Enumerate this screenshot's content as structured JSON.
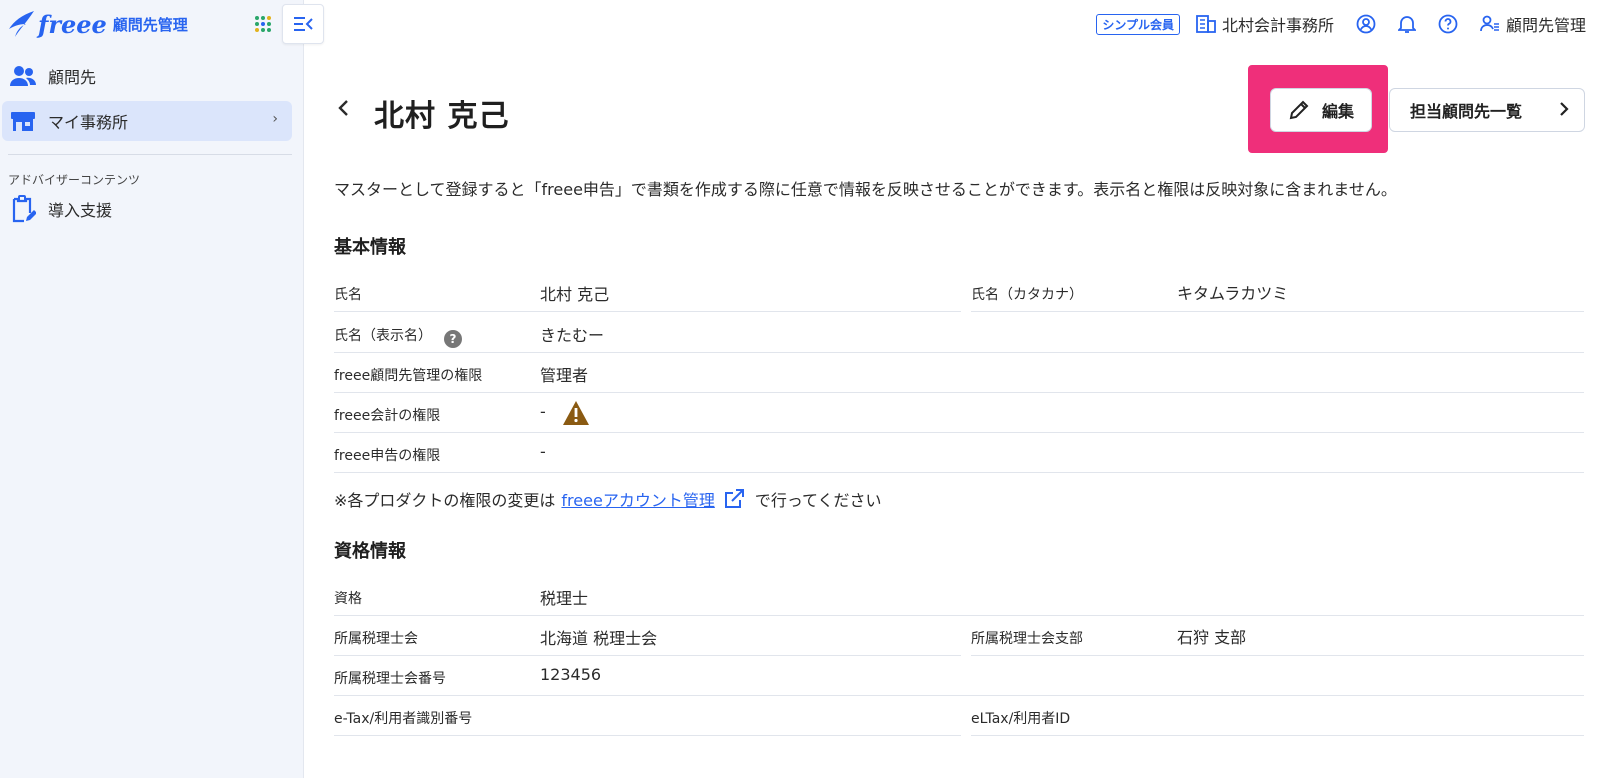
{
  "brand": {
    "logo_text": "freee",
    "product_name": "顧問先管理",
    "accent": "#2864f0",
    "highlight": "#ef2f7a"
  },
  "sidebar": {
    "items": [
      {
        "label": "顧問先",
        "icon": "users-icon"
      },
      {
        "label": "マイ事務所",
        "icon": "office-icon",
        "active": true
      }
    ],
    "section_heading": "アドバイザーコンテンツ",
    "section_items": [
      {
        "label": "導入支援",
        "icon": "clipboard-edit-icon"
      }
    ]
  },
  "header": {
    "plan_badge": "シンプル会員",
    "office_name": "北村会計事務所",
    "account_label": "顧問先管理"
  },
  "page": {
    "title": "北村 克己",
    "edit_label": "編集",
    "list_label": "担当顧問先一覧",
    "description": "マスターとして登録すると「freee申告」で書類を作成する際に任意で情報を反映させることができます。表示名と権限は反映対象に含まれません。"
  },
  "basic_info": {
    "title": "基本情報",
    "rows": [
      {
        "label": "氏名",
        "value": "北村 克己"
      },
      {
        "label": "氏名（カタカナ）",
        "value": "キタムラカツミ"
      },
      {
        "label": "氏名（表示名）",
        "value": "きたむー"
      },
      {
        "label": "freee顧問先管理の権限",
        "value": "管理者"
      },
      {
        "label": "freee会計の権限",
        "value": "-"
      },
      {
        "label": "freee申告の権限",
        "value": "-"
      }
    ]
  },
  "note": {
    "prefix": "※各プロダクトの権限の変更は",
    "link": "freeeアカウント管理",
    "suffix": "で行ってください"
  },
  "qualification": {
    "title": "資格情報",
    "rows": [
      {
        "label": "資格",
        "value": "税理士"
      },
      {
        "label": "所属税理士会",
        "value": "北海道 税理士会"
      },
      {
        "label": "所属税理士会支部",
        "value": "石狩 支部"
      },
      {
        "label": "所属税理士会番号",
        "value": "123456"
      },
      {
        "label": "e-Tax/利用者識別番号",
        "value": ""
      },
      {
        "label": "eLTax/利用者ID",
        "value": ""
      }
    ]
  }
}
